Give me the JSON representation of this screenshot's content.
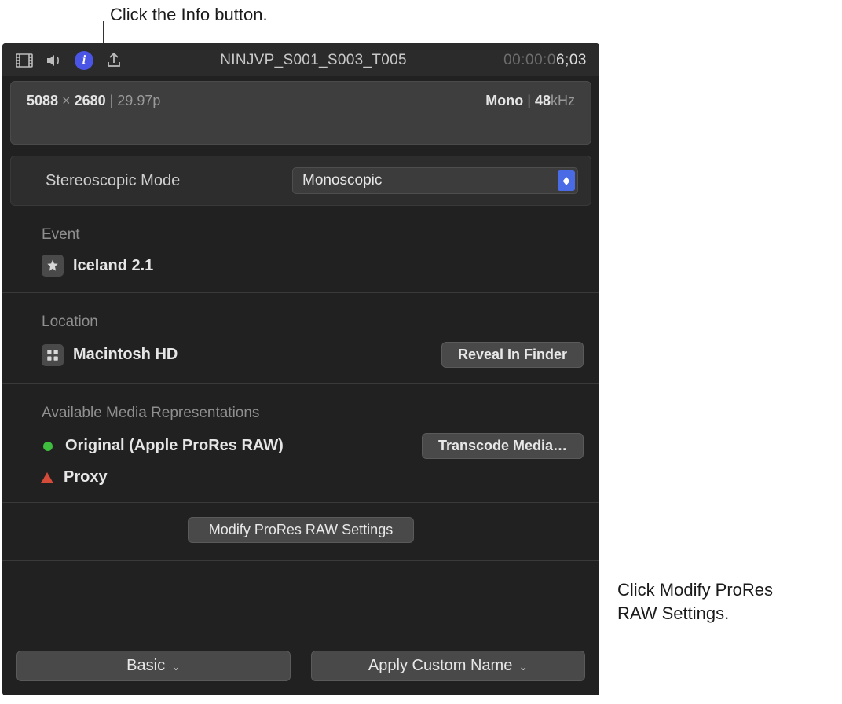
{
  "annotations": {
    "top": "Click the Info button.",
    "right_line1": "Click Modify ProRes",
    "right_line2": "RAW Settings."
  },
  "toolbar": {
    "clip_name": "NINJVP_S001_S003_T005",
    "timecode_dim": "00:00:0",
    "timecode_bright": "6;03"
  },
  "format": {
    "res_w": "5088",
    "res_sep": " × ",
    "res_h": "2680",
    "pipe": " | ",
    "fps": "29.97p",
    "audio_mode": "Mono",
    "audio_pipe": " | ",
    "audio_khz_num": "48",
    "audio_khz_unit": "kHz"
  },
  "stereo": {
    "label": "Stereoscopic Mode",
    "value": "Monoscopic"
  },
  "event": {
    "title": "Event",
    "name": "Iceland 2.1"
  },
  "location": {
    "title": "Location",
    "name": "Macintosh HD",
    "reveal_btn": "Reveal In Finder"
  },
  "media": {
    "title": "Available Media Representations",
    "original": "Original (Apple ProRes RAW)",
    "proxy": "Proxy",
    "transcode_btn": "Transcode Media…"
  },
  "modify_btn": "Modify ProRes RAW Settings",
  "footer": {
    "basic": "Basic",
    "apply_name": "Apply Custom Name"
  }
}
